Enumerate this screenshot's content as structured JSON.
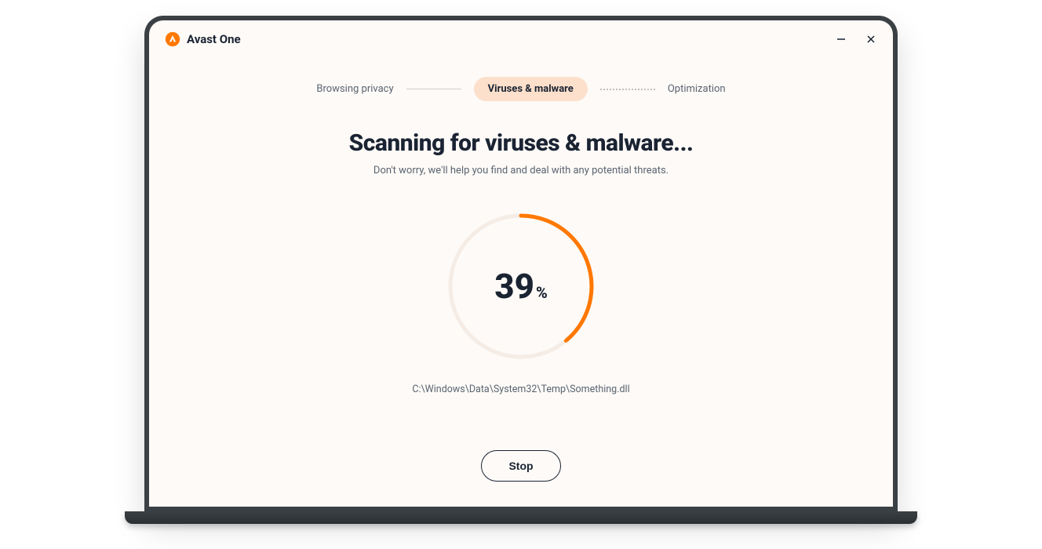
{
  "titlebar": {
    "app_name": "Avast One"
  },
  "steps": {
    "step1": "Browsing privacy",
    "step2": "Viruses & malware",
    "step3": "Optimization"
  },
  "main": {
    "heading": "Scanning for viruses & malware...",
    "subtext": "Don't worry, we'll help you find and deal with any potential threats.",
    "progress_value": "39",
    "progress_percent_symbol": "%",
    "scan_path": "C:\\Windows\\Data\\System32\\Temp\\Something.dll",
    "stop_button": "Stop"
  },
  "colors": {
    "accent": "#ff7800",
    "pill_bg": "#fde0cb",
    "text_dark": "#1a2332",
    "text_muted": "#5a6470"
  }
}
